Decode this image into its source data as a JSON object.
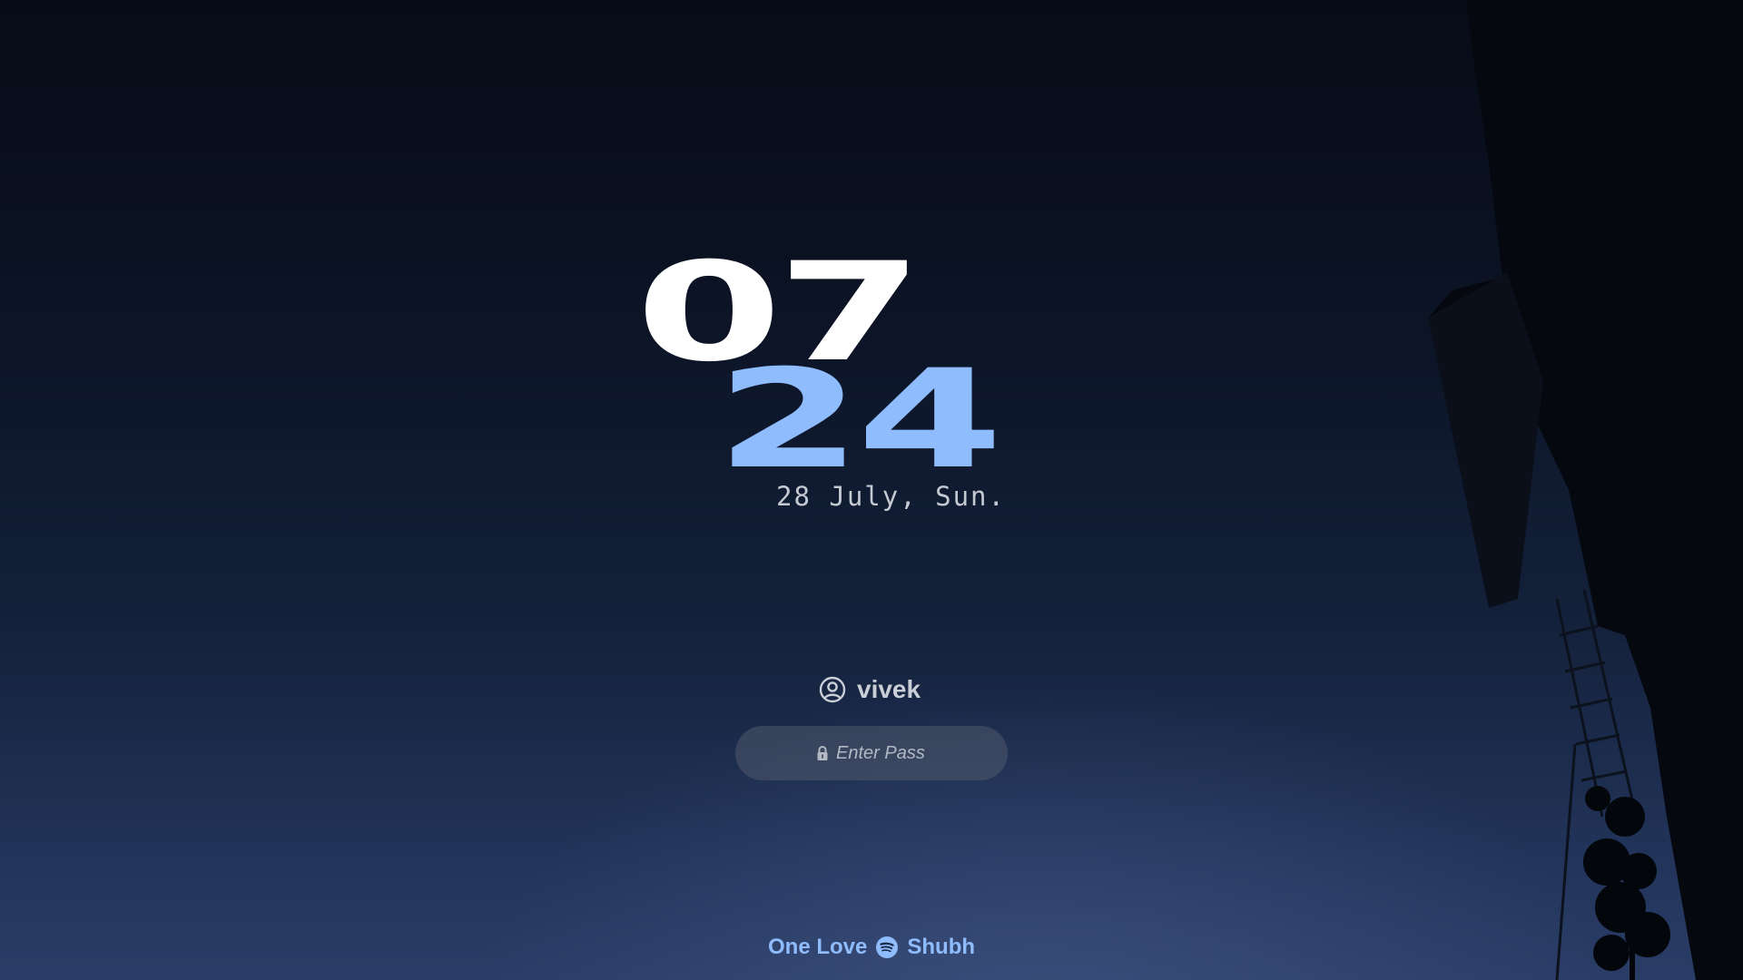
{
  "clock": {
    "hour": "07",
    "minute": "24",
    "date": "28 July, Sun."
  },
  "login": {
    "username": "vivek",
    "user_icon": "user-circle-icon",
    "password_placeholder": "Enter Pass",
    "lock_icon": "lock-icon"
  },
  "now_playing": {
    "song": "One Love",
    "artist": "Shubh",
    "icon": "spotify-icon"
  },
  "colors": {
    "accent": "#8fbcfd",
    "primary_text": "#ffffff",
    "secondary_text": "#c4c9d2"
  }
}
